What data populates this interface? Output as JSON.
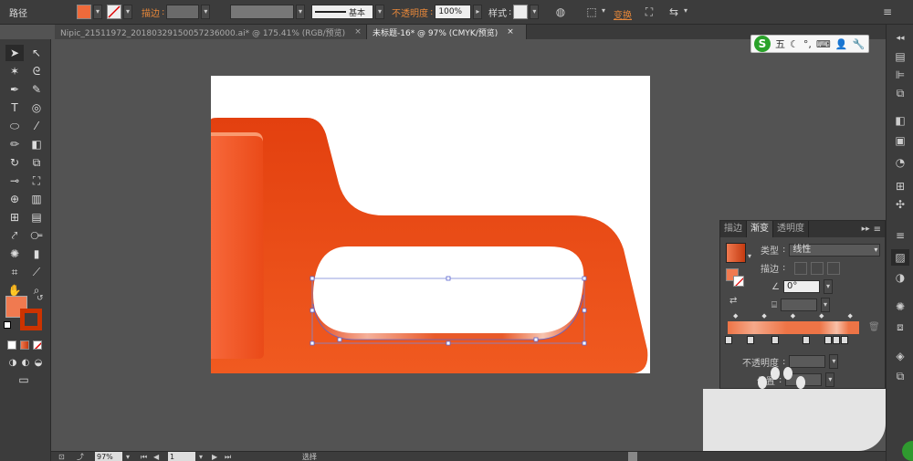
{
  "control_bar": {
    "mode_label": "路径",
    "stroke_label": "描边",
    "stroke_profile_label": "基本",
    "opacity_label": "不透明度",
    "opacity_value": "100%",
    "style_label": "样式",
    "transform_label": "变换",
    "fill_color": "#ee6a3b"
  },
  "tabs": [
    {
      "label": "Nipic_21511972_20180329150057236000.ai* @ 175.41% (RGB/预览)",
      "close": "×"
    },
    {
      "label": "未标题-16* @ 97% (CMYK/预览)",
      "close": "×"
    }
  ],
  "toolbar": {
    "fill_color": "#f07a50",
    "stroke_color": "#cc3300"
  },
  "gradient_panel": {
    "tabs": [
      "描边",
      "渐变",
      "透明度"
    ],
    "active_tab": "渐变",
    "type_label": "类型",
    "type_value": "线性",
    "stroke_label": "描边",
    "angle_value": "0°",
    "opacity_label": "不透明度",
    "location_label": "位置"
  },
  "status_bar": {
    "zoom": "97%",
    "page": "1",
    "tool_label": "选择"
  },
  "ime": {
    "logo": "S",
    "label": "五"
  },
  "colors": {
    "shape_main": "#e8471a",
    "shape_dark": "#c43a10",
    "shape_light": "#f5622c"
  }
}
